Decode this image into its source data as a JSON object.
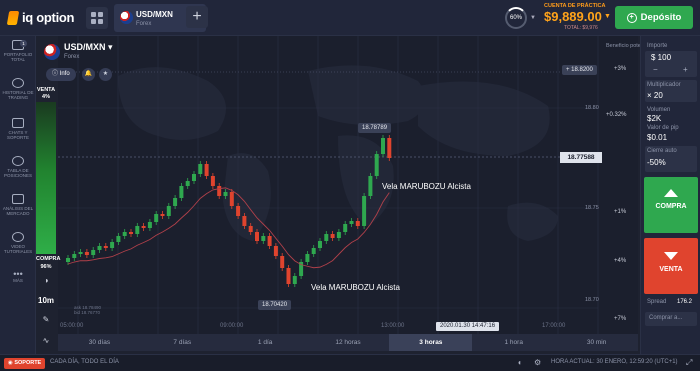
{
  "topbar": {
    "logo_text": "iq option",
    "asset_tab": {
      "name": "USD/MXN",
      "sub": "Forex"
    },
    "profit_pct": "60%",
    "account_label": "CUENTA DE PRÁCTICA",
    "balance": "$9,889.00",
    "total": "TOTAL: $9,976",
    "deposit_label": "Depósito"
  },
  "sidebar": {
    "items": [
      {
        "label": "PORTAFOLIO TOTAL",
        "badge": "1"
      },
      {
        "label": "HISTORIAL DE TRADING"
      },
      {
        "label": "CHATS Y SOPORTE"
      },
      {
        "label": "TABLA DE POSICIONES"
      },
      {
        "label": "ANÁLISIS DEL MERCADO"
      },
      {
        "label": "VIDEO TUTORIALES"
      },
      {
        "label": "MÁS"
      }
    ]
  },
  "sentiment": {
    "sell_label": "VENTA",
    "sell_pct": "4%",
    "buy_label": "COMPRA",
    "buy_pct": "96%"
  },
  "tools": {
    "timeframe": "10m"
  },
  "chart_header": {
    "asset": "USD/MXN ▾",
    "sub": "Forex",
    "info_label": "Info",
    "potential_label": "Beneficio potencial"
  },
  "chart": {
    "top_tag": "18.8200",
    "high_tag": "18.78789",
    "low_tag": "18.70420",
    "current_tag": "18.77588",
    "y_labels": [
      "18.80",
      "18.75",
      "18.70"
    ],
    "pct_labels": [
      "+3%",
      "+0.32%",
      "+1%",
      "+4%",
      "+7%"
    ],
    "annotation_top": "Vela MARUBOZU Alcista",
    "annotation_bottom": "Vela MARUBOZU Alcista",
    "x_labels": [
      "05:00:00",
      "09:00:00",
      "13:00:00",
      "17:00:00"
    ],
    "time_badge": "2020.01.30 14:47:16",
    "ask": "ask 18.78490",
    "bid": "bid 18.76770"
  },
  "periods": [
    "30 días",
    "7 días",
    "1 día",
    "12 horas",
    "3 horas",
    "1 hora",
    "30 min"
  ],
  "active_period": "3 horas",
  "rpanel": {
    "amount_label": "Importe",
    "amount": "$ 100",
    "minus": "−",
    "plus": "+",
    "mult_label": "Multiplicador",
    "mult": "× 20",
    "volume_label": "Volumen",
    "volume": "$2K",
    "pip_label": "Valor de pip",
    "pip": "$0.01",
    "autoclose_label": "Cierre auto",
    "autoclose": "-50%",
    "buy_label": "COMPRA",
    "sell_label": "VENTA",
    "spread_label": "Spread",
    "spread": "176.2",
    "buy_at": "Comprar a..."
  },
  "bottombar": {
    "support": "SOPORTE",
    "slogan": "CADA DÍA, TODO EL DÍA",
    "clock": "HORA ACTUAL: 30 ENERO, 12:59:20 (UTC+1)"
  },
  "colors": {
    "up": "#2fa84f",
    "down": "#e0442e",
    "accent": "#ffa31a"
  }
}
